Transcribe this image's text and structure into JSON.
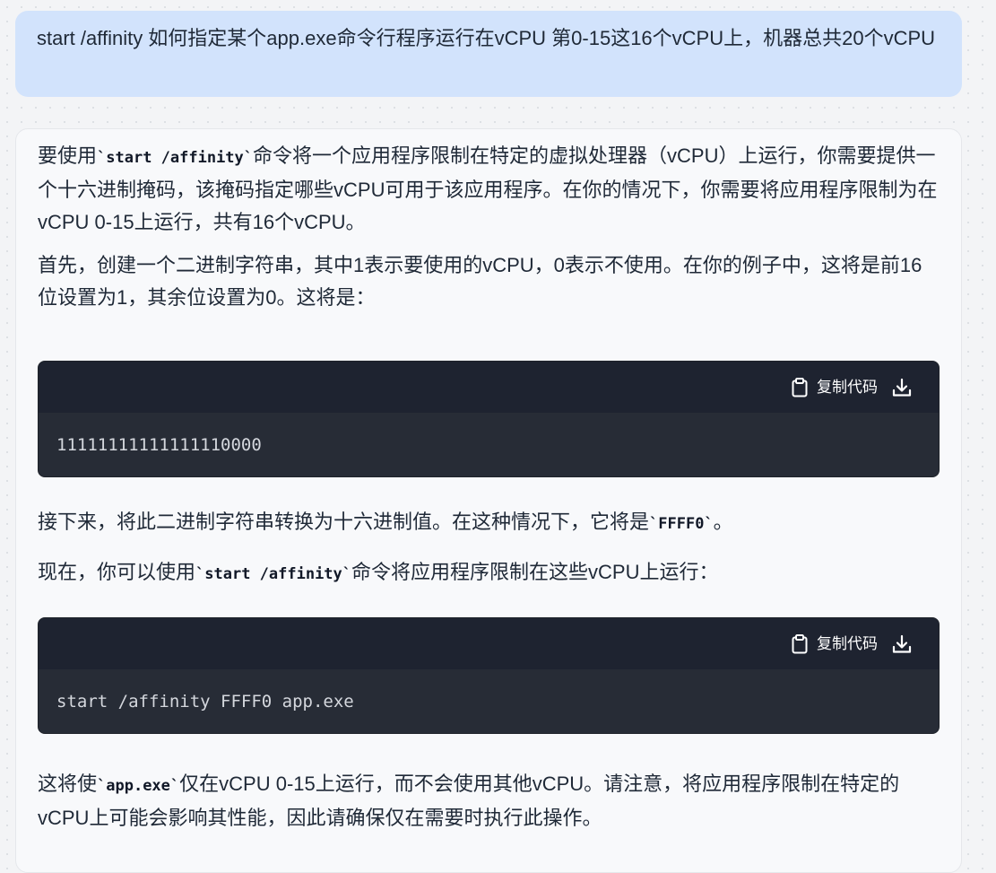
{
  "user_message": "start /affinity 如何指定某个app.exe命令行程序运行在vCPU 第0-15这16个vCPU上，机器总共20个vCPU",
  "answer": {
    "p1": {
      "before": "要使用",
      "code": "`start /affinity`",
      "after": "命令将一个应用程序限制在特定的虚拟处理器（vCPU）上运行，你需要提供一个十六进制掩码，该掩码指定哪些vCPU可用于该应用程序。在你的情况下，你需要将应用程序限制为在vCPU 0-15上运行，共有16个vCPU。"
    },
    "p2": "首先，创建一个二进制字符串，其中1表示要使用的vCPU，0表示不使用。在你的例子中，这将是前16位设置为1，其余位设置为0。这将是：",
    "code_block_1": {
      "copy_label": "复制代码",
      "copy_icon": "clipboard-icon",
      "download_icon": "download-icon",
      "code": "11111111111111110000"
    },
    "p3": {
      "before": "接下来，将此二进制字符串转换为十六进制值。在这种情况下，它将是",
      "code": "`FFFF0`",
      "after": "。"
    },
    "p4": {
      "before": "现在，你可以使用",
      "code": "`start /affinity`",
      "after": "命令将应用程序限制在这些vCPU上运行："
    },
    "code_block_2": {
      "copy_label": "复制代码",
      "copy_icon": "clipboard-icon",
      "download_icon": "download-icon",
      "code": "start /affinity FFFF0 app.exe"
    },
    "p5": {
      "before": "这将使",
      "code": "`app.exe`",
      "after": "仅在vCPU 0-15上运行，而不会使用其他vCPU。请注意，将应用程序限制在特定的vCPU上可能会影响其性能，因此请确保仅在需要时执行此操作。"
    }
  },
  "colors": {
    "user_bubble": "#d2e3fc",
    "code_bg": "#272c36",
    "code_header": "#1e2330"
  }
}
